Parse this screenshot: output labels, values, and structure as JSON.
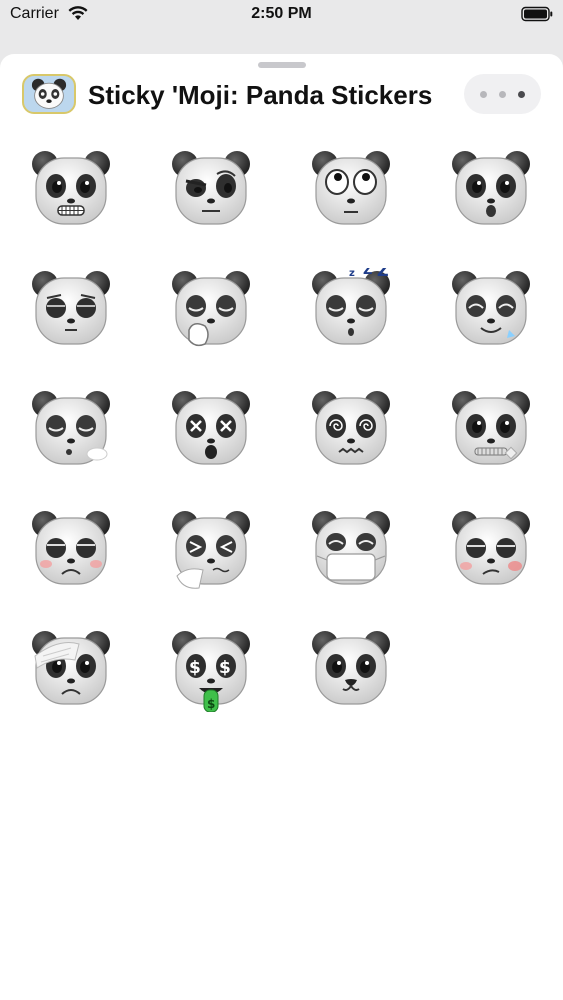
{
  "status_bar": {
    "carrier": "Carrier",
    "time": "2:50 PM"
  },
  "header": {
    "title": "Sticky 'Moji: Panda Stickers",
    "more_icon": "ellipsis-icon"
  },
  "stickers": [
    {
      "name": "grimace"
    },
    {
      "name": "skeptical"
    },
    {
      "name": "eye-roll"
    },
    {
      "name": "surprised"
    },
    {
      "name": "pleading"
    },
    {
      "name": "yawning"
    },
    {
      "name": "sleeping"
    },
    {
      "name": "relieved"
    },
    {
      "name": "exhale"
    },
    {
      "name": "dizzy"
    },
    {
      "name": "woozy"
    },
    {
      "name": "zipper-mouth"
    },
    {
      "name": "sick"
    },
    {
      "name": "sneezing"
    },
    {
      "name": "mask"
    },
    {
      "name": "nauseated"
    },
    {
      "name": "bandaged"
    },
    {
      "name": "money-mouth"
    },
    {
      "name": "cute"
    }
  ]
}
